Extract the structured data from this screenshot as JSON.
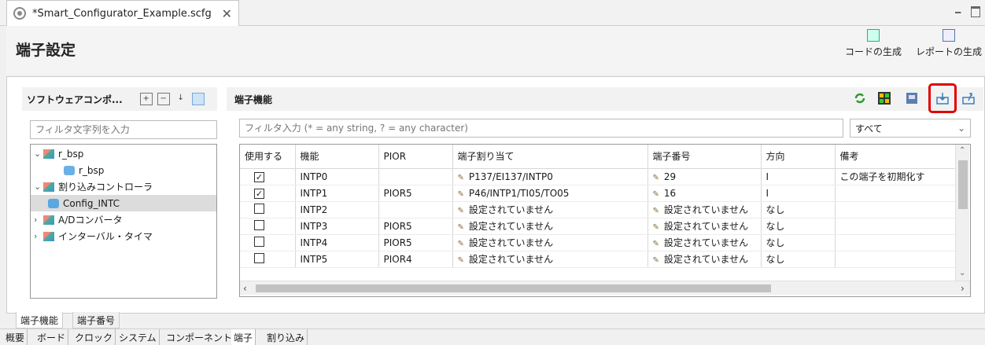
{
  "editor_tab": {
    "title": "*Smart_Configurator_Example.scfg",
    "close": "✕"
  },
  "window_controls": {
    "minimize": "━"
  },
  "header": {
    "title": "端子設定",
    "generate_code": "コードの生成",
    "generate_report": "レポートの生成"
  },
  "left_panel": {
    "title": "ソフトウェアコンポ...",
    "filter_placeholder": "フィルタ文字列を入力",
    "tree": [
      {
        "label": "r_bsp",
        "expanded": true,
        "level": 0
      },
      {
        "label": "r_bsp",
        "level": 1
      },
      {
        "label": "割り込みコントローラ",
        "expanded": true,
        "level": 0
      },
      {
        "label": "Config_INTC",
        "level": 1,
        "selected": true
      },
      {
        "label": "A/Dコンバータ",
        "expanded": false,
        "level": 0
      },
      {
        "label": "インターバル・タイマ",
        "expanded": false,
        "level": 0
      }
    ]
  },
  "right_panel": {
    "title": "端子機能",
    "filter_placeholder": "フィルタ入力 (* = any string, ? = any character)",
    "select_value": "すべて",
    "columns": [
      "使用する",
      "機能",
      "PIOR",
      "端子割り当て",
      "端子番号",
      "方向",
      "備考"
    ],
    "rows": [
      {
        "use": true,
        "func": "INTP0",
        "pior": "",
        "assign": "P137/EI137/INTP0",
        "pin": "29",
        "dir": "I",
        "note": "この端子を初期化す"
      },
      {
        "use": true,
        "func": "INTP1",
        "pior": "PIOR5",
        "assign": "P46/INTP1/TI05/TO05",
        "pin": "16",
        "dir": "I",
        "note": ""
      },
      {
        "use": false,
        "func": "INTP2",
        "pior": "",
        "assign": "設定されていません",
        "pin": "設定されていません",
        "dir": "なし",
        "note": ""
      },
      {
        "use": false,
        "func": "INTP3",
        "pior": "PIOR5",
        "assign": "設定されていません",
        "pin": "設定されていません",
        "dir": "なし",
        "note": ""
      },
      {
        "use": false,
        "func": "INTP4",
        "pior": "PIOR5",
        "assign": "設定されていません",
        "pin": "設定されていません",
        "dir": "なし",
        "note": ""
      },
      {
        "use": false,
        "func": "INTP5",
        "pior": "PIOR4",
        "assign": "設定されていません",
        "pin": "設定されていません",
        "dir": "なし",
        "note": ""
      }
    ]
  },
  "bottom_tabs": [
    "端子機能",
    "端子番号"
  ],
  "page_tabs": [
    "概要",
    "ボード",
    "クロック",
    "システム",
    "コンポーネント",
    "端子",
    "割り込み"
  ],
  "colors": {
    "highlight": "#e00000",
    "selected_row": "#dcdcdc"
  }
}
